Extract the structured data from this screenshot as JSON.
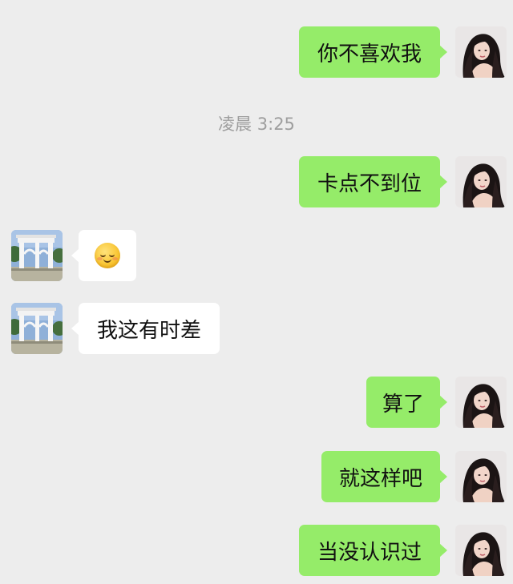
{
  "colors": {
    "background": "#ededed",
    "sent_bubble": "#95ec69",
    "received_bubble": "#ffffff",
    "timestamp_text": "#9e9e9e"
  },
  "chat": {
    "timestamp": "凌晨 3:25",
    "messages": [
      {
        "side": "sent",
        "type": "text",
        "text": "你不喜欢我"
      },
      {
        "side": "sent",
        "type": "text",
        "text": "卡点不到位"
      },
      {
        "side": "received",
        "type": "emoji",
        "icon": "smiling-face-emoji"
      },
      {
        "side": "received",
        "type": "text",
        "text": "我这有时差"
      },
      {
        "side": "sent",
        "type": "text",
        "text": "算了"
      },
      {
        "side": "sent",
        "type": "text",
        "text": "就这样吧"
      },
      {
        "side": "sent",
        "type": "text",
        "text": "当没认识过"
      }
    ]
  },
  "avatars": {
    "sender": "girl-portrait-avatar",
    "receiver": "white-archway-photo-avatar"
  }
}
